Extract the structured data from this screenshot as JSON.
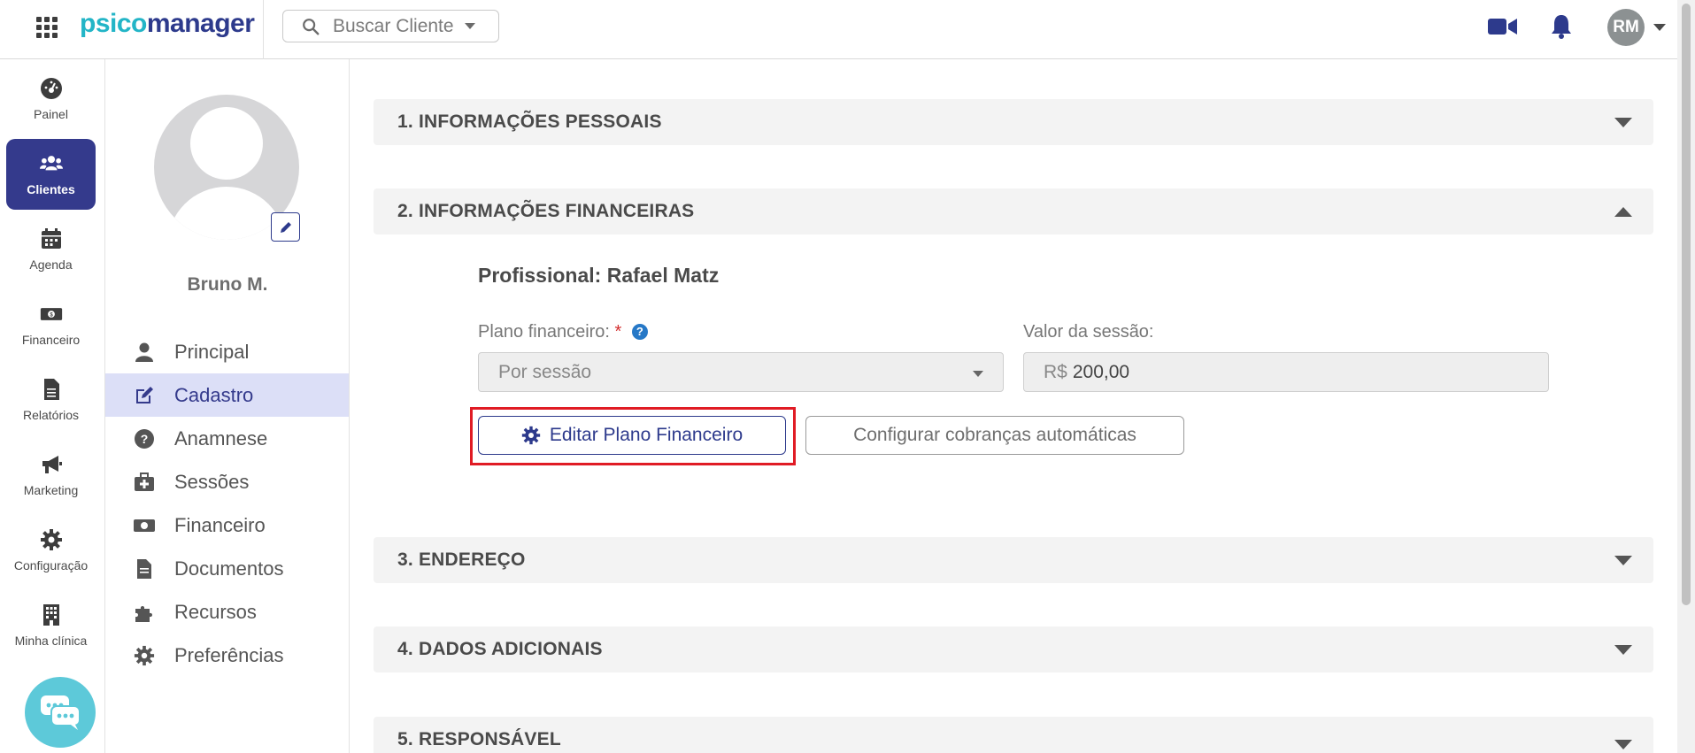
{
  "app": {
    "logo_part1": "psico",
    "logo_part2": "manager",
    "search_placeholder": "Buscar Cliente",
    "user_initials": "RM"
  },
  "nav": [
    {
      "label": "Painel",
      "icon": "dashboard-icon"
    },
    {
      "label": "Clientes",
      "icon": "users-icon",
      "active": true
    },
    {
      "label": "Agenda",
      "icon": "calendar-icon"
    },
    {
      "label": "Financeiro",
      "icon": "money-icon"
    },
    {
      "label": "Relatórios",
      "icon": "report-icon"
    },
    {
      "label": "Marketing",
      "icon": "megaphone-icon"
    },
    {
      "label": "Configuração",
      "icon": "gear-icon"
    },
    {
      "label": "Minha clínica",
      "icon": "building-icon"
    }
  ],
  "client": {
    "name": "Bruno M.",
    "menu": [
      {
        "label": "Principal",
        "icon": "user-icon"
      },
      {
        "label": "Cadastro",
        "icon": "edit-icon",
        "active": true
      },
      {
        "label": "Anamnese",
        "icon": "question-icon"
      },
      {
        "label": "Sessões",
        "icon": "medkit-icon"
      },
      {
        "label": "Financeiro",
        "icon": "money-icon"
      },
      {
        "label": "Documentos",
        "icon": "file-icon"
      },
      {
        "label": "Recursos",
        "icon": "puzzle-icon"
      },
      {
        "label": "Preferências",
        "icon": "gear-icon"
      }
    ]
  },
  "sections": [
    {
      "title": "1. INFORMAÇÕES PESSOAIS",
      "expanded": false
    },
    {
      "title": "2. INFORMAÇÕES FINANCEIRAS",
      "expanded": true
    },
    {
      "title": "3. ENDEREÇO",
      "expanded": false
    },
    {
      "title": "4. DADOS ADICIONAIS",
      "expanded": false
    },
    {
      "title": "5. RESPONSÁVEL",
      "expanded": false
    }
  ],
  "financial": {
    "profissional_label": "Profissional:",
    "profissional_name": "Rafael Matz",
    "plano_label": "Plano financeiro:",
    "required_mark": "*",
    "help_glyph": "?",
    "plano_value": "Por sessão",
    "valor_label": "Valor da sessão:",
    "currency": "R$",
    "valor_value": "200,00",
    "edit_button": "Editar Plano Financeiro",
    "auto_button": "Configurar cobranças automáticas"
  },
  "colors": {
    "brand_dark": "#2d3a8c",
    "brand_light": "#23b5c7",
    "nav_active": "#343a8c",
    "highlight": "#e01b24"
  }
}
